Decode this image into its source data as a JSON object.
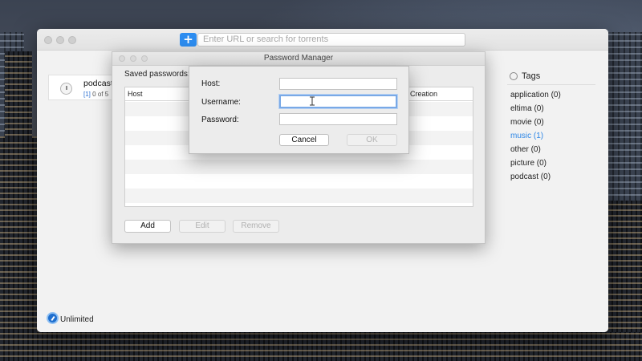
{
  "app": {
    "search_placeholder": "Enter URL or search for torrents",
    "add_label": "+"
  },
  "torrent": {
    "name": "podcast",
    "index": "[1]",
    "progress_text": "0 of 5",
    "pause_glyph": "II"
  },
  "tags": {
    "title": "Tags",
    "items": [
      {
        "label": "application (0)",
        "active": false
      },
      {
        "label": "eltima (0)",
        "active": false
      },
      {
        "label": "movie (0)",
        "active": false
      },
      {
        "label": "music (1)",
        "active": true
      },
      {
        "label": "other (0)",
        "active": false
      },
      {
        "label": "picture (0)",
        "active": false
      },
      {
        "label": "podcast (0)",
        "active": false
      }
    ],
    "active_color": "#2c86e6"
  },
  "status": {
    "speed_mode": "Unlimited"
  },
  "password_manager": {
    "title": "Password Manager",
    "saved_label": "Saved passwords:",
    "columns": [
      "Host",
      "Creation"
    ],
    "buttons": {
      "add": "Add",
      "edit": "Edit",
      "remove": "Remove"
    }
  },
  "dialog": {
    "host_label": "Host:",
    "username_label": "Username:",
    "password_label": "Password:",
    "host_value": "",
    "username_value": "",
    "password_value": "",
    "cancel": "Cancel",
    "ok": "OK"
  },
  "colors": {
    "accent": "#2d8df0"
  }
}
